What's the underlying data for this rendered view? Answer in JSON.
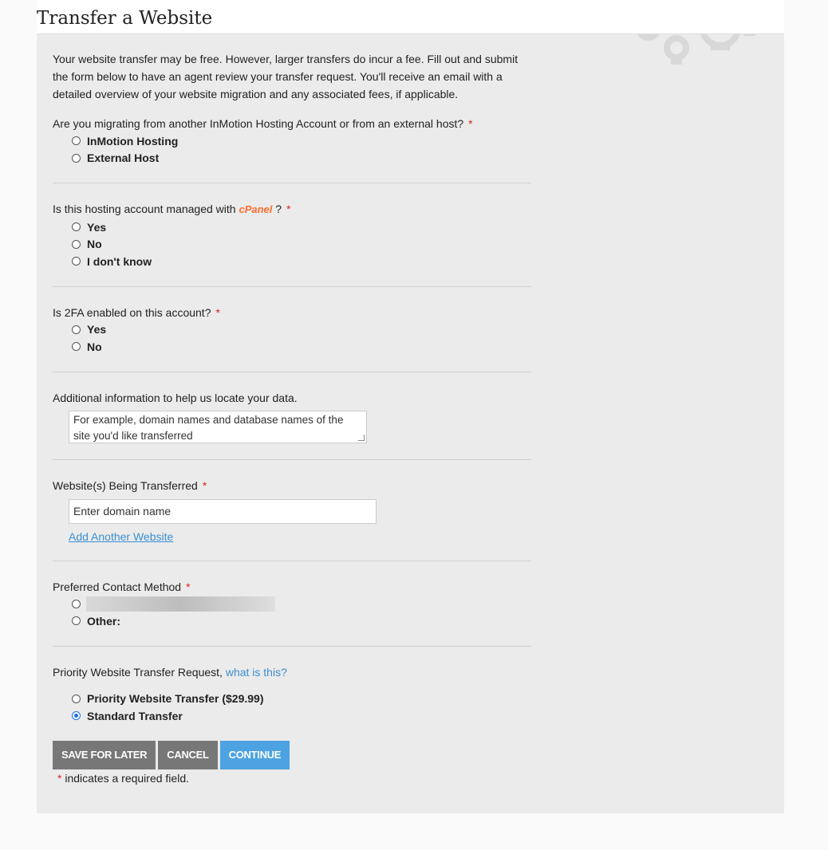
{
  "header": {
    "title": "Transfer a Website"
  },
  "intro": "Your website transfer may be free. However, larger transfers do incur a fee. Fill out and submit the form below to have an agent review your transfer request. You'll receive an email with a detailed overview of your website migration and any associated fees, if applicable.",
  "q1": {
    "label": "Are you migrating from another InMotion Hosting Account or from an external host?",
    "required": "*",
    "options": [
      "InMotion Hosting",
      "External Host"
    ]
  },
  "q2": {
    "label_pre": "Is this hosting account managed with",
    "brand": "cPanel",
    "label_post": "?",
    "required": "*",
    "options": [
      "Yes",
      "No",
      "I don't know"
    ]
  },
  "q3": {
    "label": "Is 2FA enabled on this account?",
    "required": "*",
    "options": [
      "Yes",
      "No"
    ]
  },
  "q4": {
    "label": "Additional information to help us locate your data.",
    "placeholder": "For example, domain names and database names of the site you'd like transferred"
  },
  "q5": {
    "label": "Website(s) Being Transferred",
    "required": "*",
    "placeholder": "Enter domain name",
    "add_link": "Add Another Website"
  },
  "q6": {
    "label": "Preferred Contact Method",
    "required": "*",
    "other_label": "Other:"
  },
  "q7": {
    "label": "Priority Website Transfer Request,",
    "info_link": "what is this?",
    "options": [
      "Priority Website Transfer ($29.99)",
      "Standard Transfer"
    ],
    "selected": "Standard Transfer"
  },
  "actions": {
    "save": "Save For Later",
    "cancel": "Cancel",
    "continue": "Continue"
  },
  "footer": {
    "asterisk": "*",
    "note": "indicates a required field."
  }
}
